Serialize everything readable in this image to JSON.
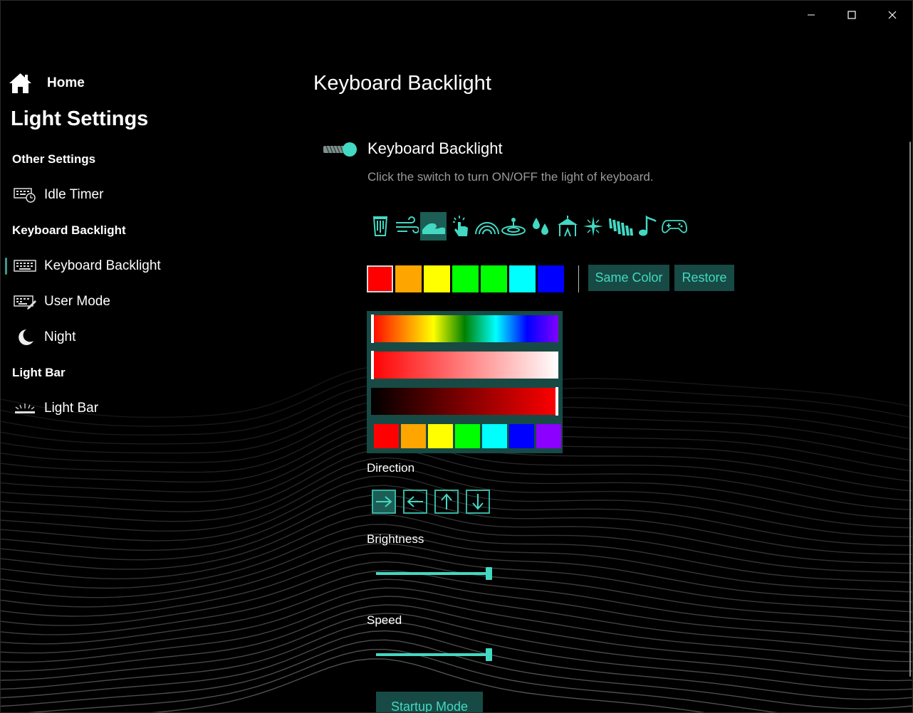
{
  "window": {
    "controls": [
      "minimize-icon",
      "maximize-icon",
      "close-icon"
    ]
  },
  "sidebar": {
    "home": "Home",
    "title": "Light Settings",
    "sections": [
      {
        "label": "Other Settings",
        "items": [
          {
            "label": "Idle Timer",
            "icon": "keyboard-timer-icon"
          }
        ]
      },
      {
        "label": "Keyboard Backlight",
        "items": [
          {
            "label": "Keyboard Backlight",
            "icon": "keyboard-icon",
            "selected": true
          },
          {
            "label": "User Mode",
            "icon": "keyboard-edit-icon"
          },
          {
            "label": "Night",
            "icon": "moon-icon"
          }
        ]
      },
      {
        "label": "Light Bar",
        "items": [
          {
            "label": "Light Bar",
            "icon": "light-bar-icon"
          }
        ]
      }
    ]
  },
  "main": {
    "title": "Keyboard Backlight",
    "toggle": {
      "label": "Keyboard Backlight",
      "on": true,
      "description": "Click the switch to turn ON/OFF the light of keyboard."
    },
    "effects": [
      "static-icon",
      "breath-wind-icon",
      "wave-icon",
      "touch-icon",
      "rainbow-icon",
      "ripple-icon",
      "raindrop-icon",
      "circus-icon",
      "star-icon",
      "aurora-icon",
      "music-icon",
      "gamepad-icon"
    ],
    "active_effect": 2,
    "zone_colors": [
      "#ff0000",
      "#ffa500",
      "#ffff00",
      "#00ff00",
      "#00ff00",
      "#00ffff",
      "#0000ff"
    ],
    "selected_zone": 0,
    "buttons": {
      "same_color": "Same Color",
      "restore": "Restore"
    },
    "picker": {
      "hue_position": 0.0,
      "saturation_position": 0.0,
      "value_position": 1.0,
      "palette": [
        "#ff0000",
        "#ffa500",
        "#ffff00",
        "#00ff00",
        "#00ffff",
        "#0000ff",
        "#8b00ff"
      ]
    },
    "direction": {
      "label": "Direction",
      "options": [
        "arrow-right-icon",
        "arrow-left-icon",
        "arrow-up-icon",
        "arrow-down-icon"
      ],
      "active": 0
    },
    "brightness": {
      "label": "Brightness",
      "value": 1.0
    },
    "speed": {
      "label": "Speed",
      "value": 1.0
    },
    "startup": "Startup Mode"
  },
  "colors": {
    "accent": "#43d8c2",
    "accent_bg": "#174a44",
    "active_bg": "#1c5e55"
  }
}
